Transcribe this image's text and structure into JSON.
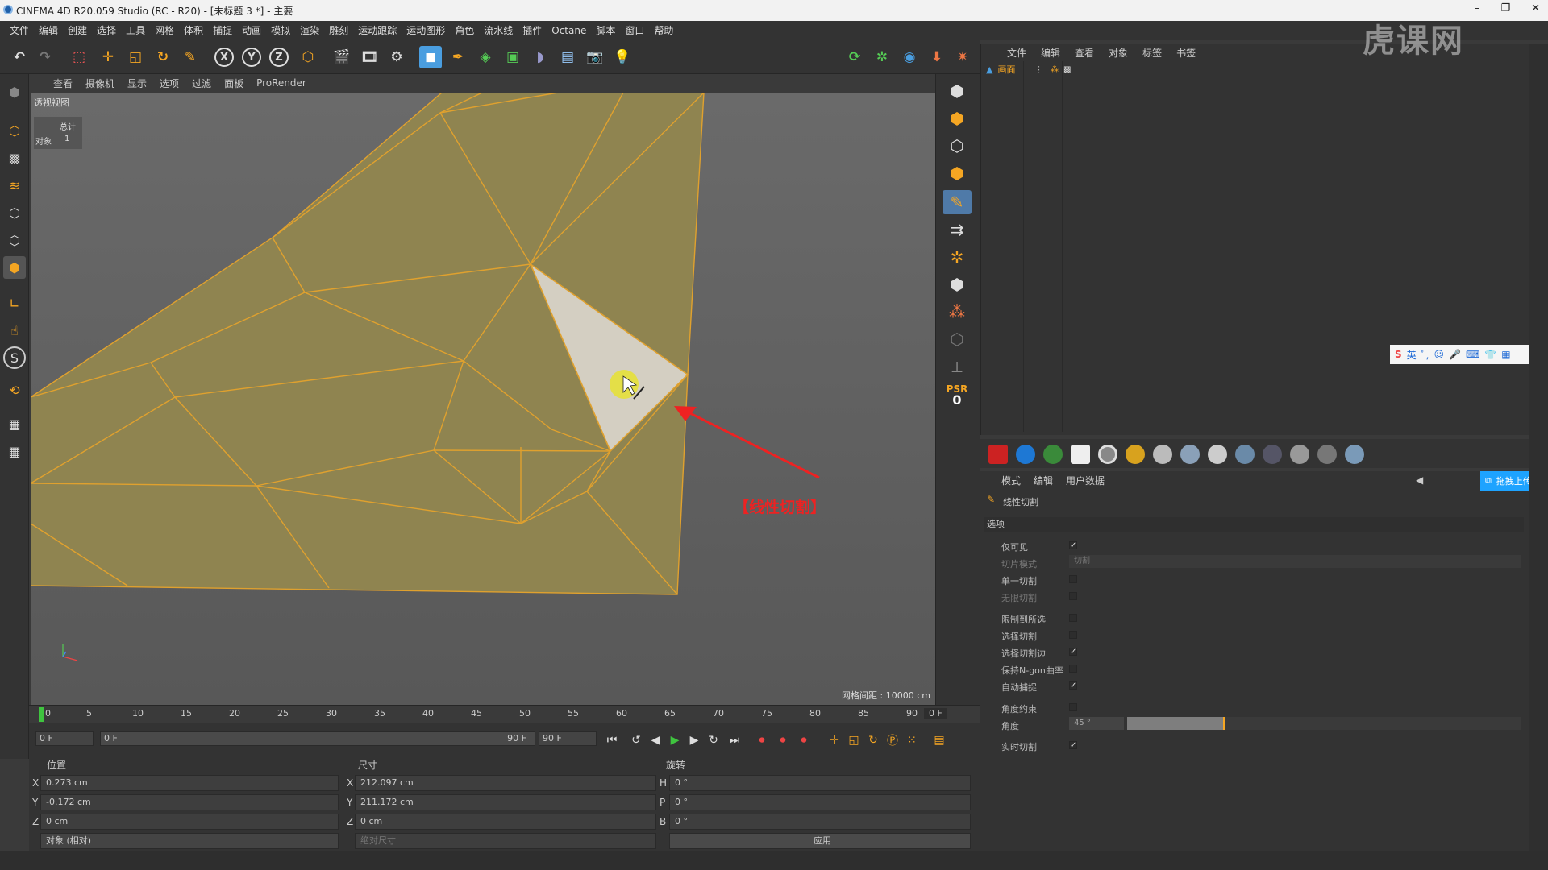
{
  "window": {
    "title": "CINEMA 4D R20.059 Studio (RC - R20) - [未标题 3 *] - 主要",
    "controls": [
      "–",
      "❐",
      "✕"
    ]
  },
  "menu": [
    "文件",
    "编辑",
    "创建",
    "选择",
    "工具",
    "网格",
    "体积",
    "捕捉",
    "动画",
    "模拟",
    "渲染",
    "雕刻",
    "运动跟踪",
    "运动图形",
    "角色",
    "流水线",
    "插件",
    "Octane",
    "脚本",
    "窗口",
    "帮助"
  ],
  "toolbar": {
    "axis_x": "X",
    "axis_y": "Y",
    "axis_z": "Z"
  },
  "viewport": {
    "menu": [
      "查看",
      "摄像机",
      "显示",
      "选项",
      "过滤",
      "面板",
      "ProRender"
    ],
    "label": "透视视图",
    "hud": {
      "head": "总计",
      "row_label": "对象",
      "row_value": "1"
    },
    "grid": "网格间距 : 10000 cm",
    "annotation": "【线性切割】"
  },
  "right_tools": {
    "psr": "PSR",
    "psr_value": "0"
  },
  "timeline": {
    "ticks": [
      "0",
      "5",
      "10",
      "15",
      "20",
      "25",
      "30",
      "35",
      "40",
      "45",
      "50",
      "55",
      "60",
      "65",
      "70",
      "75",
      "80",
      "85",
      "90"
    ],
    "end_frame": "0 F"
  },
  "transport": {
    "start": "0 F",
    "range_start": "0 F",
    "range_end": "90 F",
    "end": "90 F"
  },
  "coords": {
    "headers": [
      "位置",
      "尺寸",
      "旋转"
    ],
    "pos": [
      {
        "axis": "X",
        "value": "0.273 cm"
      },
      {
        "axis": "Y",
        "value": "-0.172 cm"
      },
      {
        "axis": "Z",
        "value": "0 cm"
      }
    ],
    "size": [
      {
        "axis": "X",
        "value": "212.097 cm"
      },
      {
        "axis": "Y",
        "value": "211.172 cm"
      },
      {
        "axis": "Z",
        "value": "0 cm"
      }
    ],
    "rot": [
      {
        "axis": "H",
        "value": "0 °"
      },
      {
        "axis": "P",
        "value": "0 °"
      },
      {
        "axis": "B",
        "value": "0 °"
      }
    ],
    "mode": "对象 (相对)",
    "size_mode": "绝对尺寸",
    "apply": "应用"
  },
  "object_manager": {
    "menu": [
      "文件",
      "编辑",
      "查看",
      "对象",
      "标签",
      "书签"
    ],
    "item": "画面"
  },
  "attr": {
    "menu": [
      "模式",
      "编辑",
      "用户数据"
    ],
    "tool": "线性切割",
    "section": "选项",
    "rows": [
      {
        "label": "仅可见",
        "checked": true
      },
      {
        "label": "切片模式",
        "value": "切割"
      },
      {
        "label": "单一切割",
        "checked": false
      },
      {
        "label": "无限切割",
        "checked": false
      },
      {
        "label": "限制到所选",
        "checked": false
      },
      {
        "label": "选择切割",
        "checked": false
      },
      {
        "label": "选择切割边",
        "checked": true
      },
      {
        "label": "保持N-gon曲率",
        "checked": false
      },
      {
        "label": "自动捕捉",
        "checked": true
      },
      {
        "label": "角度约束",
        "checked": false
      },
      {
        "label": "角度",
        "value": "45 °"
      },
      {
        "label": "实时切割",
        "checked": true
      }
    ],
    "upload": "拖拽上传"
  },
  "ime": {
    "lang": "英"
  },
  "watermark": "虎课网",
  "colors": {
    "accent": "#1ea3ff",
    "mesh": "#8f8450",
    "edge": "#e0a12e",
    "annotation": "#ee2222"
  }
}
